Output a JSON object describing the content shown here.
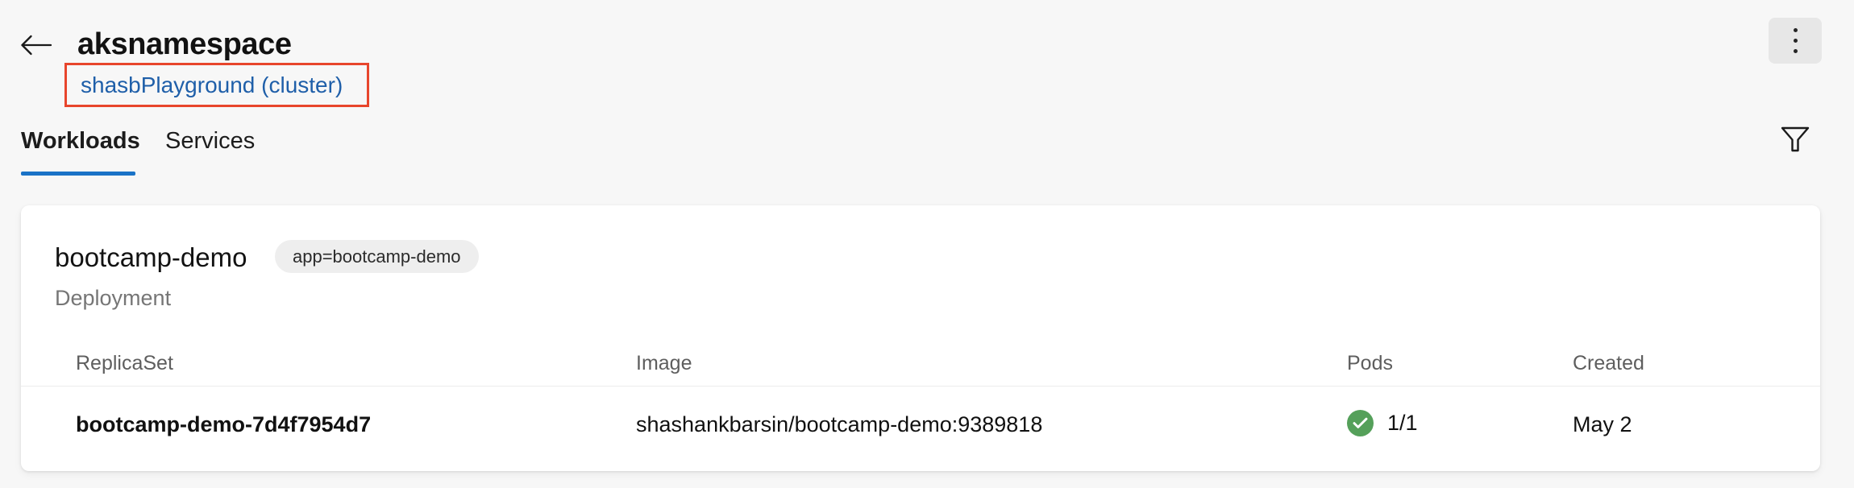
{
  "header": {
    "back_icon": "arrow-left-icon",
    "title": "aksnamespace",
    "cluster_link": "shasbPlayground (cluster)",
    "menu_icon": "kebab-menu-icon",
    "highlight_color": "#e8452c",
    "link_color": "#1f5fa9"
  },
  "tabs": {
    "items": [
      {
        "label": "Workloads",
        "active": true
      },
      {
        "label": "Services",
        "active": false
      }
    ],
    "active_color": "#1a73c7",
    "filter_icon": "filter-funnel-icon"
  },
  "card": {
    "workload_name": "bootcamp-demo",
    "label_chip": "app=bootcamp-demo",
    "kind": "Deployment",
    "table": {
      "columns": [
        "ReplicaSet",
        "Image",
        "Pods",
        "Created"
      ],
      "rows": [
        {
          "replicaset": "bootcamp-demo-7d4f7954d7",
          "image": "shashankbarsin/bootcamp-demo:9389818",
          "pods": "1/1",
          "pods_status": "healthy",
          "pods_status_icon": "check-circle-icon",
          "pods_status_color": "#55a05a",
          "created": "May 2"
        }
      ]
    }
  }
}
